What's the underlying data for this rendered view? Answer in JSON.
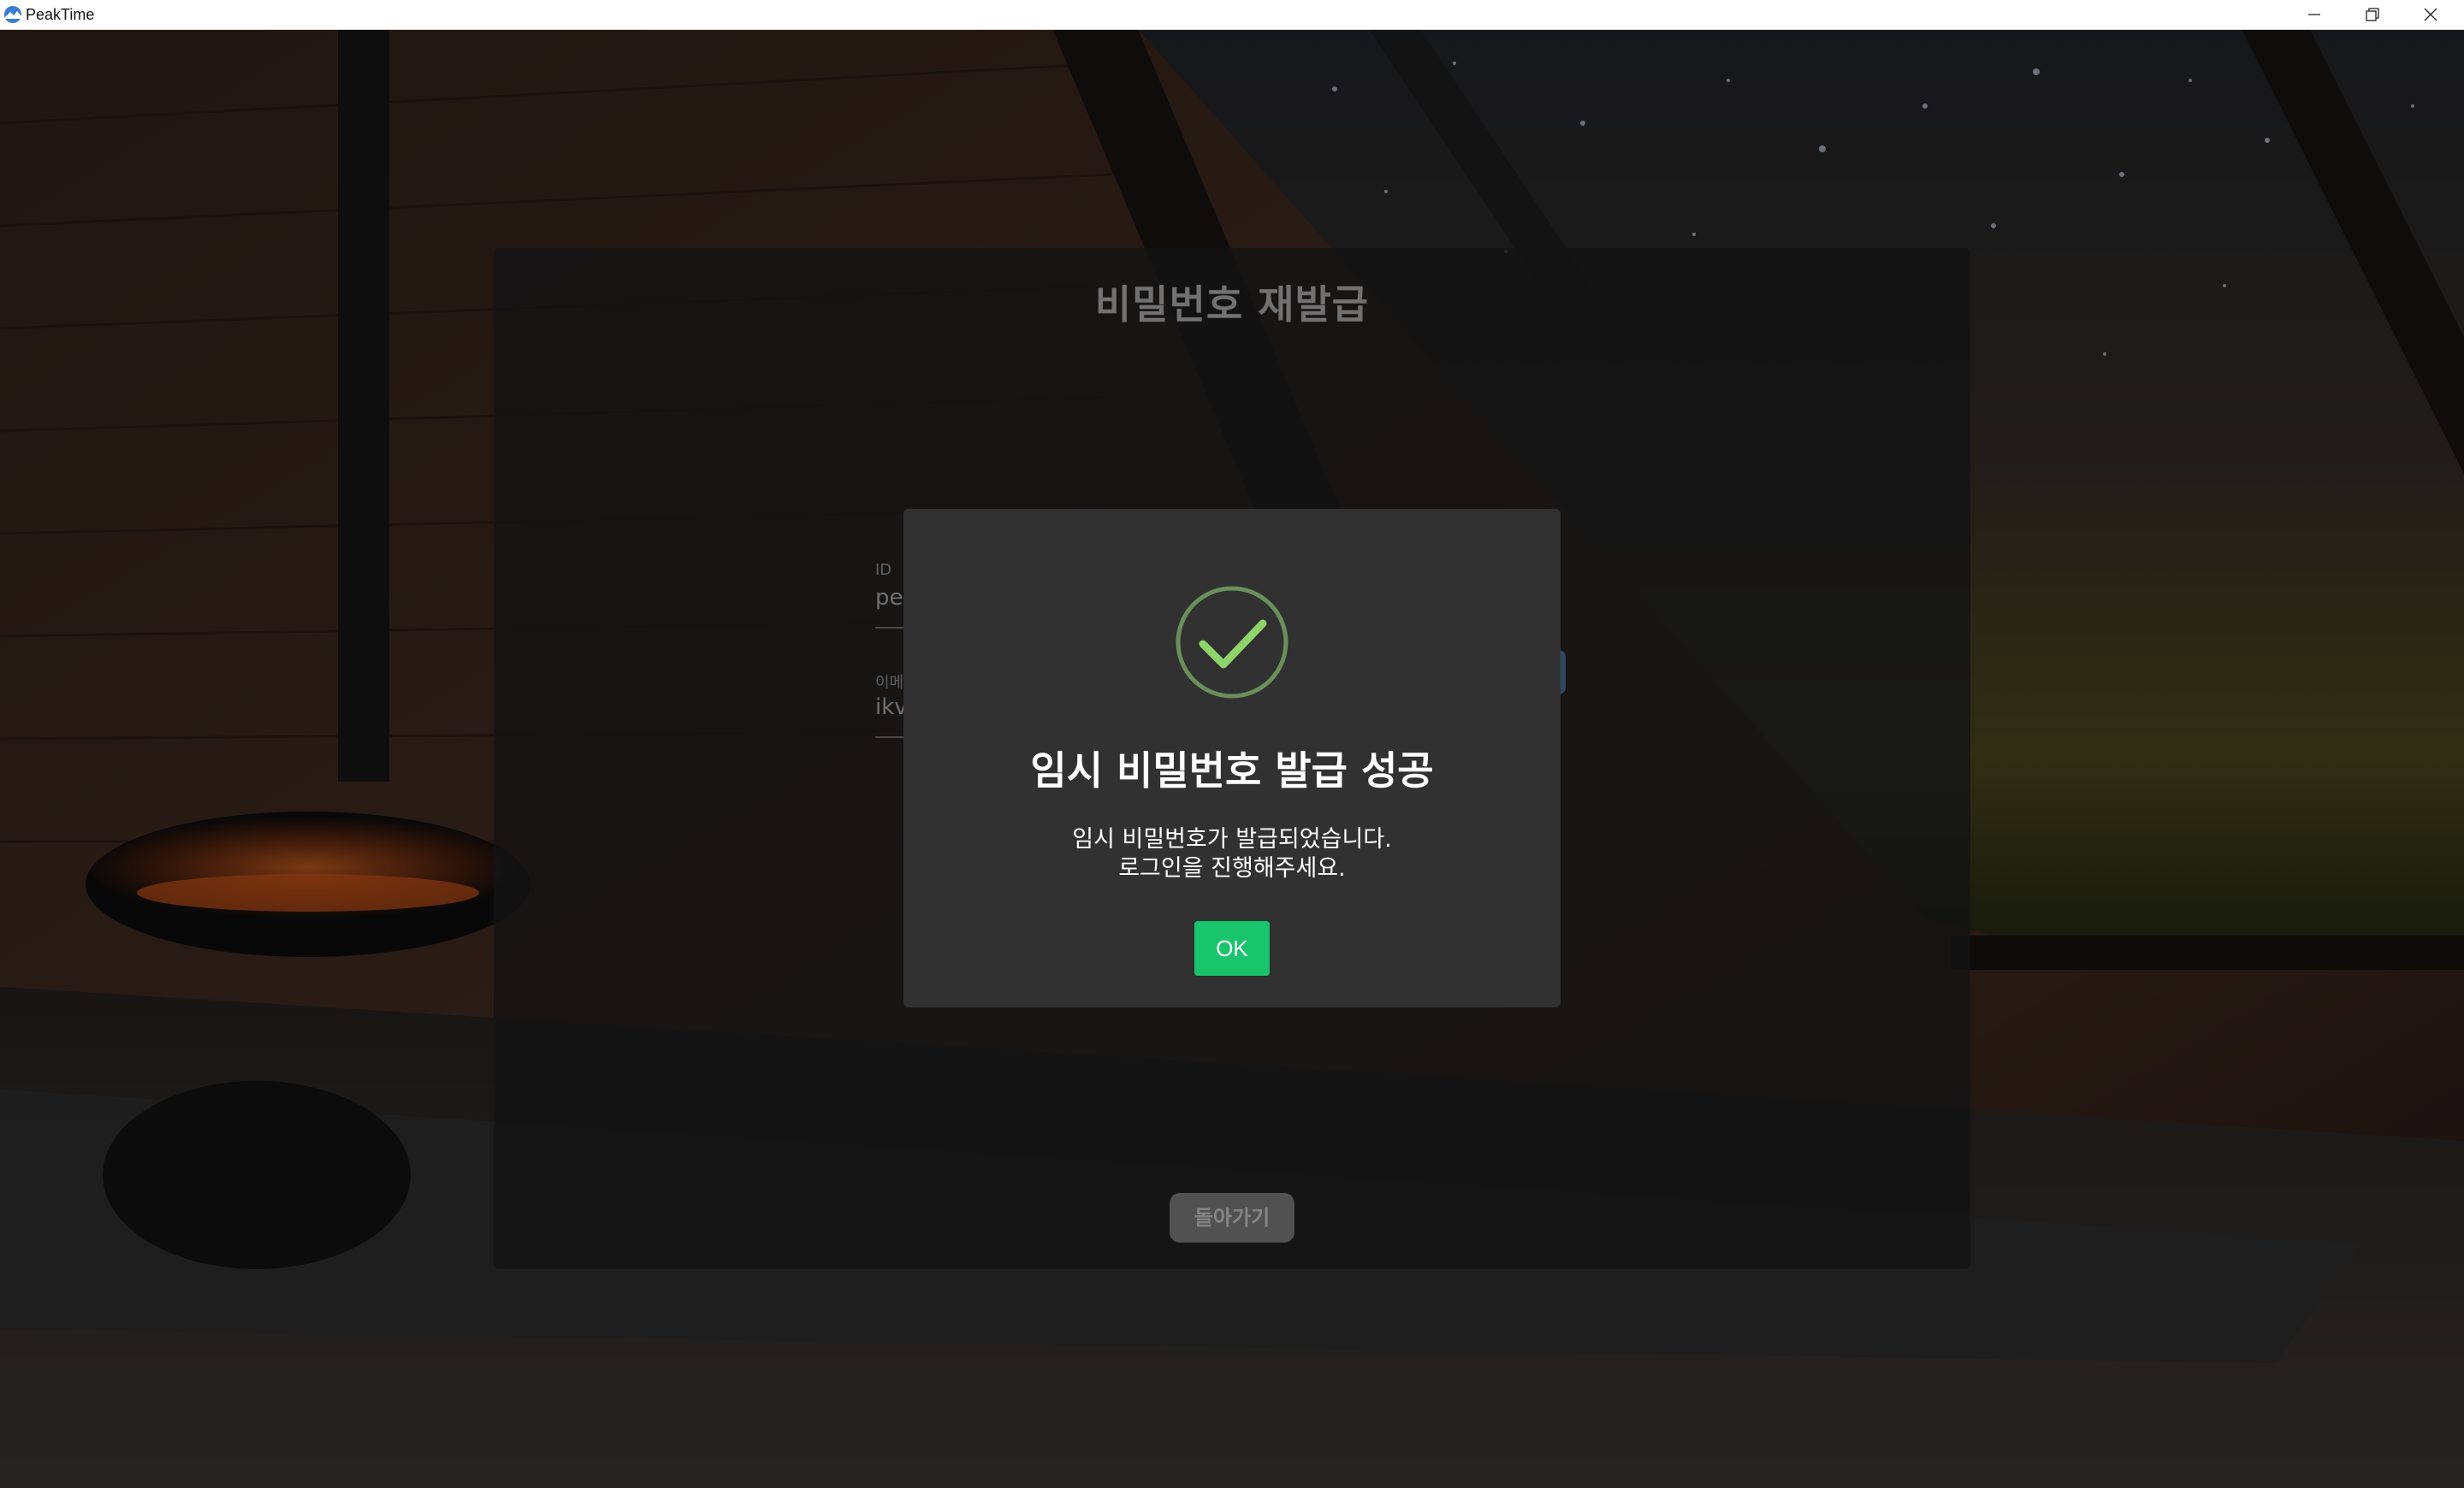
{
  "window": {
    "title": "PeakTime",
    "icon": "peaktime-logo-icon",
    "controls": [
      "minimize-icon",
      "maximize-icon",
      "close-icon"
    ]
  },
  "panel": {
    "title": "비밀번호 재발급",
    "id_label": "ID",
    "id_value_partial": "pec",
    "email_label_partial": "이메",
    "email_value_partial": "ikv",
    "back_button_label": "돌아가기"
  },
  "dialog": {
    "icon": "check-circle-icon",
    "title": "임시 비밀번호 발급 성공",
    "message_line1": "임시 비밀번호가 발급되었습니다.",
    "message_line2": "로그인을 진행해주세요.",
    "ok_label": "OK"
  },
  "colors": {
    "ok_button": "#18c46c",
    "check_stroke": "#8fd46a",
    "dialog_bg": "#313131",
    "panel_bg": "#262628"
  }
}
